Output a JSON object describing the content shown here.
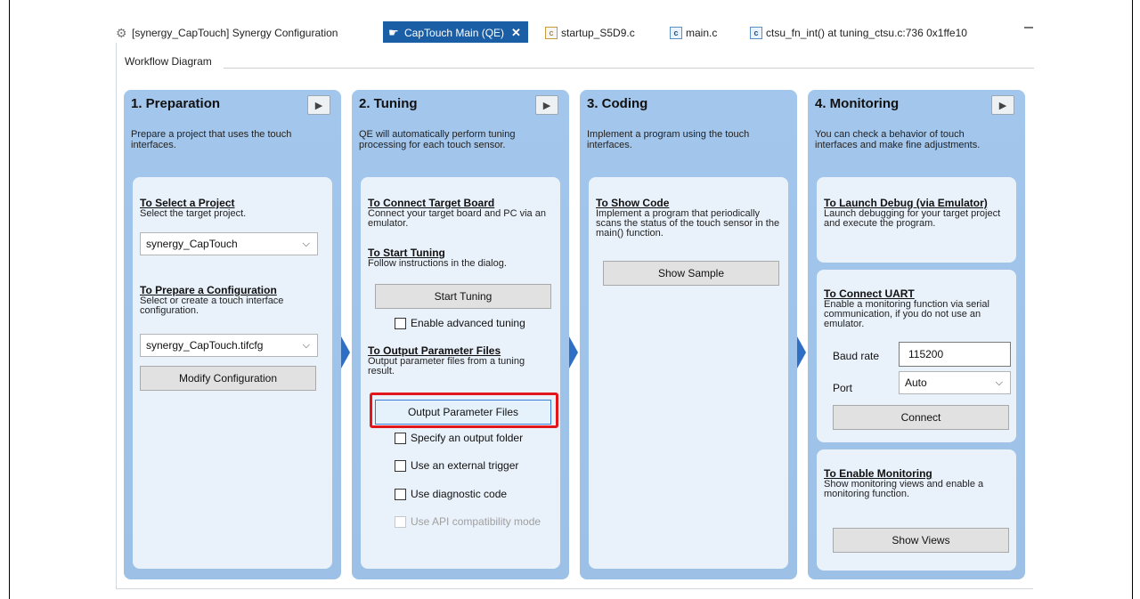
{
  "tabs": [
    {
      "label": "[synergy_CapTouch] Synergy Configuration",
      "icon": "gear-icon",
      "active": false
    },
    {
      "label": "CapTouch Main (QE)",
      "icon": "touch-hand-icon",
      "active": true,
      "close": "✕"
    },
    {
      "label": "startup_S5D9.c",
      "icon": "c-file-icon",
      "active": false
    },
    {
      "label": "main.c",
      "icon": "c-file-icon",
      "active": false
    },
    {
      "label": "ctsu_fn_int() at tuning_ctsu.c:736 0x1ffe10",
      "icon": "c-file-icon",
      "active": false
    }
  ],
  "workflow_label": "Workflow Diagram",
  "columns": {
    "preparation": {
      "title": "1. Preparation",
      "desc": "Prepare a project that uses the touch interfaces.",
      "select_project": {
        "title": "To Select a Project",
        "desc": "Select the target project.",
        "value": "synergy_CapTouch"
      },
      "prepare_config": {
        "title": "To Prepare a Configuration",
        "desc": "Select or create a touch interface configuration.",
        "value": "synergy_CapTouch.tifcfg",
        "button": "Modify Configuration"
      }
    },
    "tuning": {
      "title": "2. Tuning",
      "desc": "QE will automatically perform tuning processing for each touch sensor.",
      "connect": {
        "title": "To Connect Target Board",
        "desc": "Connect your target board and PC via an emulator."
      },
      "start": {
        "title": "To Start Tuning",
        "desc": "Follow instructions in the dialog.",
        "button": "Start Tuning",
        "checkbox": "Enable advanced tuning"
      },
      "output": {
        "title": "To Output Parameter Files",
        "desc": "Output parameter files from a tuning result.",
        "button": "Output Parameter Files"
      },
      "options": [
        "Specify an output folder",
        "Use an external trigger",
        "Use diagnostic code",
        "Use API compatibility mode"
      ]
    },
    "coding": {
      "title": "3. Coding",
      "desc": "Implement a program using the touch interfaces.",
      "show_code": {
        "title": "To Show Code",
        "desc": "Implement a program that periodically scans the status of the touch sensor in the main() function.",
        "button": "Show Sample"
      }
    },
    "monitoring": {
      "title": "4. Monitoring",
      "desc": "You can check a behavior of touch interfaces and make fine adjustments.",
      "launch": {
        "title": "To Launch Debug (via Emulator)",
        "desc": "Launch debugging for your target project and execute the program."
      },
      "uart": {
        "title": "To Connect UART",
        "desc": "Enable a monitoring function via serial communication, if you do not use an emulator.",
        "baud_label": "Baud rate",
        "baud_value": "115200",
        "port_label": "Port",
        "port_value": "Auto",
        "button": "Connect"
      },
      "enable": {
        "title": "To Enable Monitoring",
        "desc": "Show monitoring views and enable a monitoring function.",
        "button": "Show Views"
      }
    }
  },
  "colors": {
    "accent": "#1a5ea6",
    "column_bg": "#a3c6ec",
    "panel_bg": "#e9f1fa",
    "arrow": "#2e6fc4",
    "highlight": "#e3161b"
  }
}
